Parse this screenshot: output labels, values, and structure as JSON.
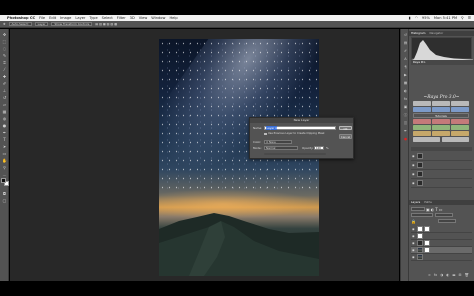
{
  "menubar": {
    "app_name": "Photoshop CC",
    "items": [
      "File",
      "Edit",
      "Image",
      "Layer",
      "Type",
      "Select",
      "Filter",
      "3D",
      "View",
      "Window",
      "Help"
    ],
    "right_status": [
      "95%",
      "Mon 5:41 PM"
    ]
  },
  "options_bar": {
    "items": [
      "Auto-Select:",
      "Layer",
      "Show Transform Controls"
    ]
  },
  "dialog": {
    "title": "New Layer",
    "name_label": "Name:",
    "name_value": "Layer 4",
    "clipping_label": "Use Previous Layer to Create Clipping Mask",
    "color_label": "Color:",
    "color_value": "None",
    "mode_label": "Mode:",
    "mode_value": "Normal",
    "opacity_label": "Opacity:",
    "opacity_value": "100",
    "opacity_unit": "%",
    "ok_label": "OK",
    "cancel_label": "Cancel"
  },
  "histogram_panel": {
    "tabs": [
      "Histogram",
      "Navigator"
    ]
  },
  "raya_panel": {
    "title": "~Raya Pro 3.0~",
    "tab": "Tutorials"
  },
  "layers_panel": {
    "tabs": [
      "Layers",
      "Paths"
    ]
  },
  "colors": {
    "panel_bg": "#535353",
    "workspace_bg": "#282828",
    "menubar_bg": "#f2f2f2",
    "dialog_bg": "#535353",
    "raya_buttons": [
      "#b9b9b9",
      "#7c9ac8",
      "#c47a7a",
      "#8fb57a",
      "#c6a86a"
    ]
  }
}
